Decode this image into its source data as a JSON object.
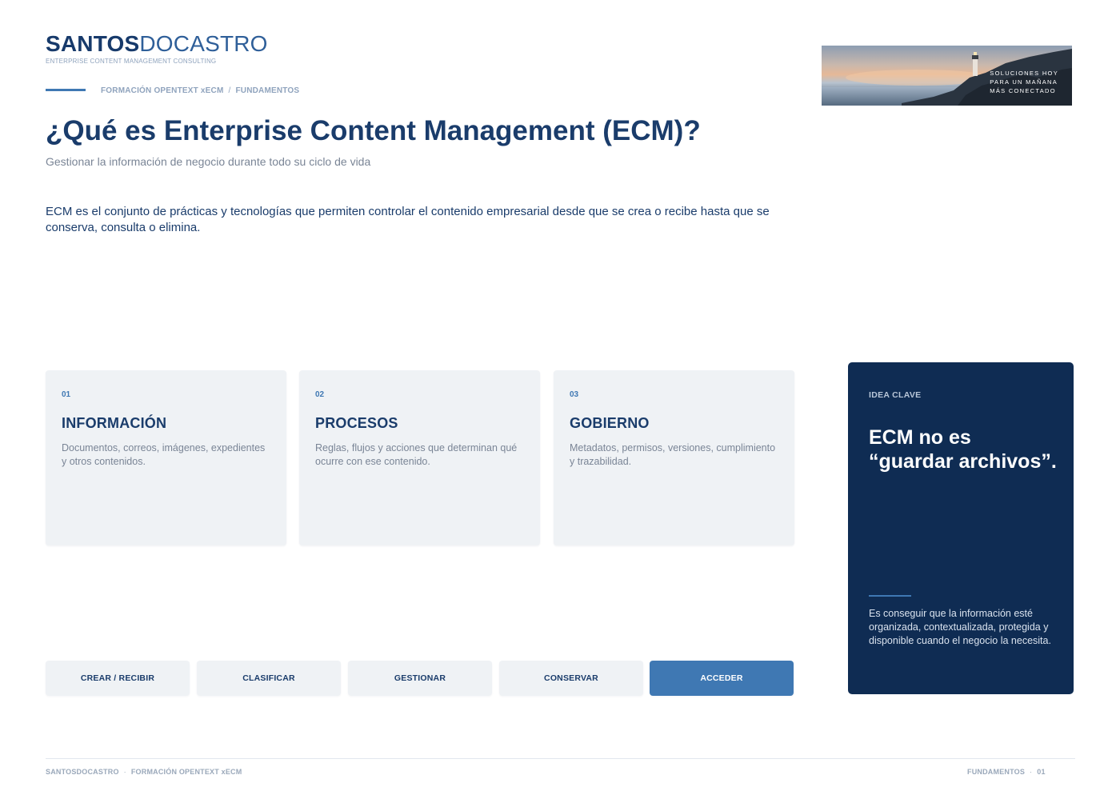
{
  "brand": {
    "name_bold": "SANTOS",
    "name_light": "DOCASTRO",
    "tagline": "ENTERPRISE CONTENT MANAGEMENT CONSULTING"
  },
  "breadcrumb": {
    "course": "FORMACIÓN OPENTEXT xECM",
    "separator": "/",
    "section": "FUNDAMENTOS"
  },
  "hero_image": {
    "line1": "SOLUCIONES HOY",
    "line2": "PARA UN MAÑANA",
    "line3": "MÁS CONECTADO"
  },
  "title": "¿Qué es Enterprise Content Management (ECM)?",
  "subtitle": "Gestionar la información de negocio durante todo su ciclo de vida",
  "intro": "ECM es el conjunto de prácticas y tecnologías que permiten controlar el contenido empresarial desde que se crea o recibe hasta que se conserva, consulta o elimina.",
  "cards": [
    {
      "number": "01",
      "title": "INFORMACIÓN",
      "description": "Documentos, correos, imágenes, expedientes y otros contenidos."
    },
    {
      "number": "02",
      "title": "PROCESOS",
      "description": "Reglas, flujos y acciones que determinan qué ocurre con ese contenido."
    },
    {
      "number": "03",
      "title": "GOBIERNO",
      "description": "Metadatos, permisos, versiones, cumplimiento y trazabilidad."
    }
  ],
  "key_idea": {
    "label": "IDEA CLAVE",
    "quote": "ECM no es “guardar archivos”.",
    "body": "Es conseguir que la información esté organizada, contextualizada, protegida y disponible cuando el negocio la necesita."
  },
  "lifecycle_steps": [
    {
      "label": "CREAR / RECIBIR"
    },
    {
      "label": "CLASIFICAR"
    },
    {
      "label": "GESTIONAR"
    },
    {
      "label": "CONSERVAR"
    },
    {
      "label": "ACCEDER"
    }
  ],
  "active_step": "ACCEDER",
  "footer": {
    "left_1": "SANTOSDOCASTRO",
    "left_2": "FORMACIÓN OPENTEXT xECM",
    "right_1": "FUNDAMENTOS",
    "right_2": "01",
    "dot": "·"
  },
  "colors": {
    "navy": "#1a3c6b",
    "accent": "#3f78b3",
    "panel": "#0f2c53",
    "card_bg": "#eff2f5",
    "muted": "#7a8596"
  }
}
